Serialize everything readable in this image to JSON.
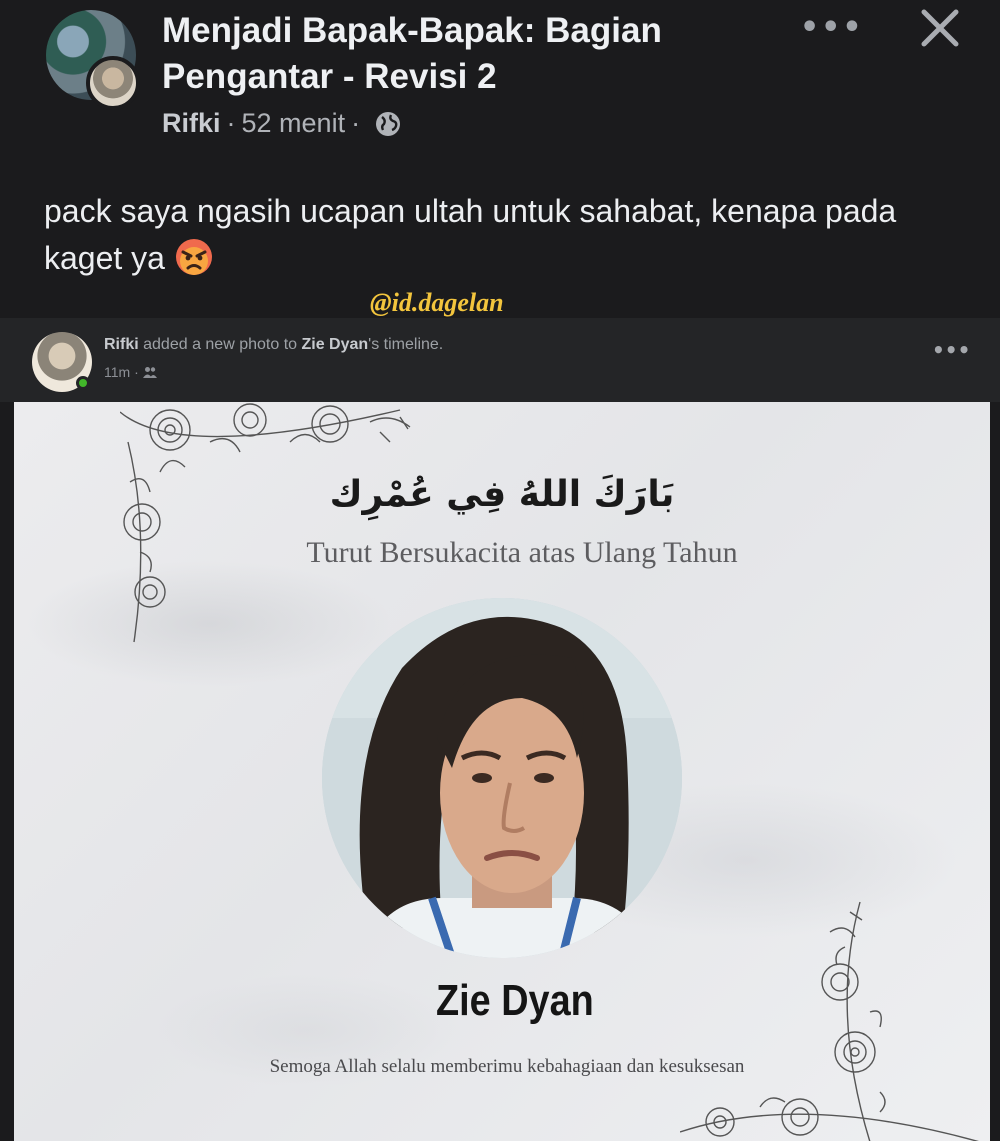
{
  "post": {
    "title": "Menjadi Bapak-Bapak: Bagian Pengantar - Revisi 2",
    "author": "Rifki",
    "time": "52 menit",
    "text": "pack saya ngasih ucapan ultah untuk sahabat, kenapa pada kaget ya",
    "more_icon": "more-dots-icon",
    "close_icon": "close-icon",
    "privacy_icon": "globe-icon",
    "emoji_icon": "angry-face-emoji"
  },
  "watermark": "@id.dagelan",
  "embedded": {
    "author": "Rifki",
    "action": "added a new photo to",
    "target": "Zie Dyan",
    "suffix": "'s timeline.",
    "time": "11m",
    "audience_icon": "friends-icon"
  },
  "card": {
    "arabic": "بَارَكَ اللهُ فِي عُمْرِك",
    "subtitle": "Turut Bersukacita atas Ulang Tahun",
    "name": "Zie Dyan",
    "wish": "Semoga Allah selalu memberimu kebahagiaan dan kesuksesan"
  },
  "colors": {
    "background": "#1b1b1d",
    "embed_bar": "#242527",
    "watermark": "#f3c53d",
    "card_bg": "#e8e9eb"
  }
}
